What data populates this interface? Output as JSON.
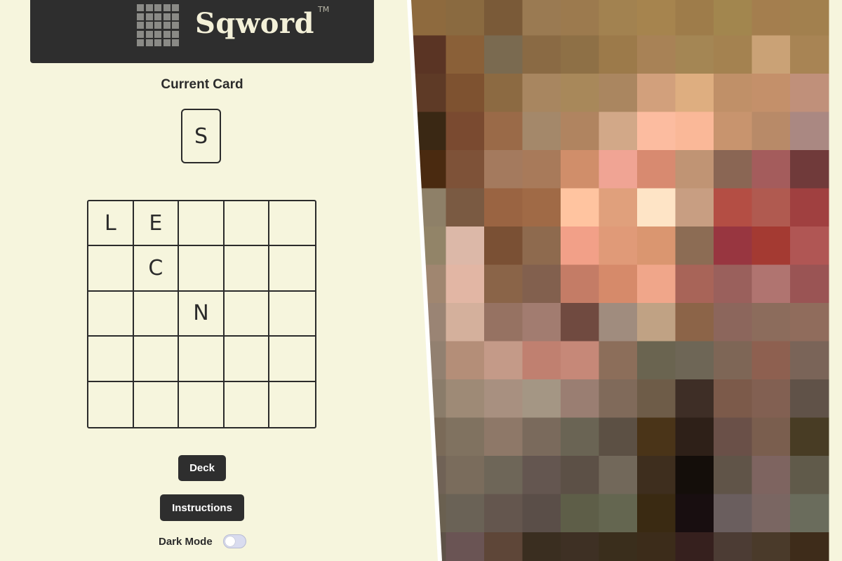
{
  "header": {
    "brand": "Sqword",
    "trademark": "TM"
  },
  "current_card": {
    "title": "Current Card",
    "letter": "S"
  },
  "board": {
    "rows": [
      [
        "L",
        "E",
        "",
        "",
        ""
      ],
      [
        "",
        "C",
        "",
        "",
        ""
      ],
      [
        "",
        "",
        "N",
        "",
        ""
      ],
      [
        "",
        "",
        "",
        "",
        ""
      ],
      [
        "",
        "",
        "",
        "",
        ""
      ]
    ]
  },
  "buttons": {
    "deck": "Deck",
    "instructions": "Instructions"
  },
  "dark_mode": {
    "label": "Dark Mode",
    "enabled": false
  },
  "colors": {
    "background": "#f6f5dd",
    "header_bg": "#2e2e2e",
    "ink": "#2b2b2b"
  },
  "photo_colors": [
    [
      "#8e6a3e",
      "#8a6a40",
      "#7a5a38",
      "#9a7a52",
      "#9c7a4e",
      "#a28250",
      "#a6844e",
      "#9e7c4a",
      "#a2864e",
      "#a47e4e",
      "#a2804e"
    ],
    [
      "#5a3424",
      "#8a6038",
      "#7a6a50",
      "#8a6a44",
      "#8e7046",
      "#9c7a4a",
      "#a88256",
      "#a48654",
      "#a48250",
      "#caa276",
      "#a88454"
    ],
    [
      "#5e3a26",
      "#7e5230",
      "#8c6a42",
      "#a88660",
      "#a8885a",
      "#aa8660",
      "#d2a07c",
      "#deae80",
      "#c09068",
      "#c4906a",
      "#c0907a"
    ],
    [
      "#3a2814",
      "#7a4a30",
      "#9a6a48",
      "#a4886a",
      "#b08460",
      "#d2a888",
      "#fcbca0",
      "#fab898",
      "#c8946e",
      "#b88a68",
      "#aa8882"
    ],
    [
      "#4a2a10",
      "#7e5238",
      "#a47a5e",
      "#a87a5a",
      "#d08e6a",
      "#f0a494",
      "#d88a70",
      "#c09474",
      "#8a6654",
      "#a45c5c",
      "#703a3a"
    ],
    [
      "#8e8068",
      "#7a5a42",
      "#9a6442",
      "#a06a46",
      "#ffc4a0",
      "#e0a07c",
      "#fee4c6",
      "#c89e82",
      "#b44e44",
      "#b05a50",
      "#a04040"
    ],
    [
      "#928468",
      "#dcb8a8",
      "#7a5034",
      "#8e6a4e",
      "#f2a088",
      "#e09a78",
      "#da9670",
      "#8c6c54",
      "#983640",
      "#a43a32",
      "#b05654"
    ],
    [
      "#a08670",
      "#e2b6a4",
      "#8a6448",
      "#82604e",
      "#c47c66",
      "#d68a6a",
      "#f0a68a",
      "#a86458",
      "#9a605c",
      "#b07470",
      "#9a5454"
    ],
    [
      "#9a8474",
      "#d4b09c",
      "#967262",
      "#a27c70",
      "#704a40",
      "#a08c7e",
      "#c0a284",
      "#8c6448",
      "#8c665c",
      "#8c6c5c",
      "#906c5c"
    ],
    [
      "#928070",
      "#b48e78",
      "#c49a88",
      "#c08070",
      "#c68878",
      "#8c6e5a",
      "#6a6450",
      "#6e6656",
      "#7e6656",
      "#8e6050",
      "#7a6458"
    ],
    [
      "#8a7c6a",
      "#9e8a76",
      "#a89080",
      "#a49684",
      "#9a7e72",
      "#806a5a",
      "#6e5c48",
      "#3e2e26",
      "#7c5a4a",
      "#826052",
      "#605248"
    ],
    [
      "#7a6a58",
      "#807260",
      "#8e7868",
      "#7a6a5c",
      "#6a6454",
      "#5c5044",
      "#4a3418",
      "#2e2018",
      "#6a5048",
      "#7a5e4e",
      "#483c24"
    ],
    [
      "#706256",
      "#7a6c5c",
      "#6e6658",
      "#645650",
      "#5c5046",
      "#72685a",
      "#3e2e1e",
      "#140e0a",
      "#605448",
      "#7e6460",
      "#605a4a"
    ],
    [
      "#6a6050",
      "#6a6256",
      "#64564e",
      "#5a4e48",
      "#5e5e48",
      "#646650",
      "#3a2a12",
      "#180e10",
      "#6a5e5e",
      "#7a6662",
      "#6a6c5c"
    ],
    [
      "#5e5248",
      "#6a5454",
      "#5e4638",
      "#3a2e20",
      "#3e3024",
      "#3a2e1c",
      "#3c2c1a",
      "#36201e",
      "#4c3c34",
      "#4a3a2a",
      "#3e2c1a"
    ]
  ]
}
